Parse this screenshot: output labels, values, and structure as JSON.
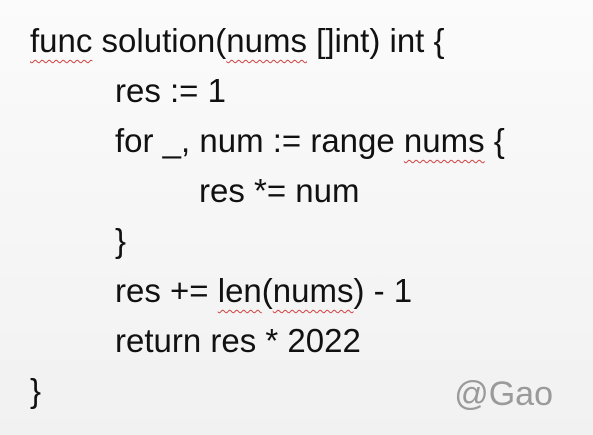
{
  "code": {
    "line1": {
      "squiggled": "func",
      "rest_a": " solution(",
      "squiggled_b": "nums",
      "rest_b": " []int) int {"
    },
    "line2": {
      "text": "res := 1"
    },
    "line3": {
      "rest_a": "for _, num := range ",
      "squiggled": "nums",
      "rest_b": " {"
    },
    "line4": {
      "text": "res *= num"
    },
    "line5": {
      "text": "}"
    },
    "line6": {
      "rest_a": "res += ",
      "squiggled": "len",
      "rest_b": "(",
      "squiggled_b": "nums",
      "rest_c": ") - 1"
    },
    "line7": {
      "text": "return res * 2022"
    },
    "line8": {
      "text": "}"
    }
  },
  "watermark": {
    "text": "@Gao"
  },
  "colors": {
    "text": "#111111",
    "spellcheck_squiggle": "#d04040",
    "watermark": "#9a9a9a"
  }
}
